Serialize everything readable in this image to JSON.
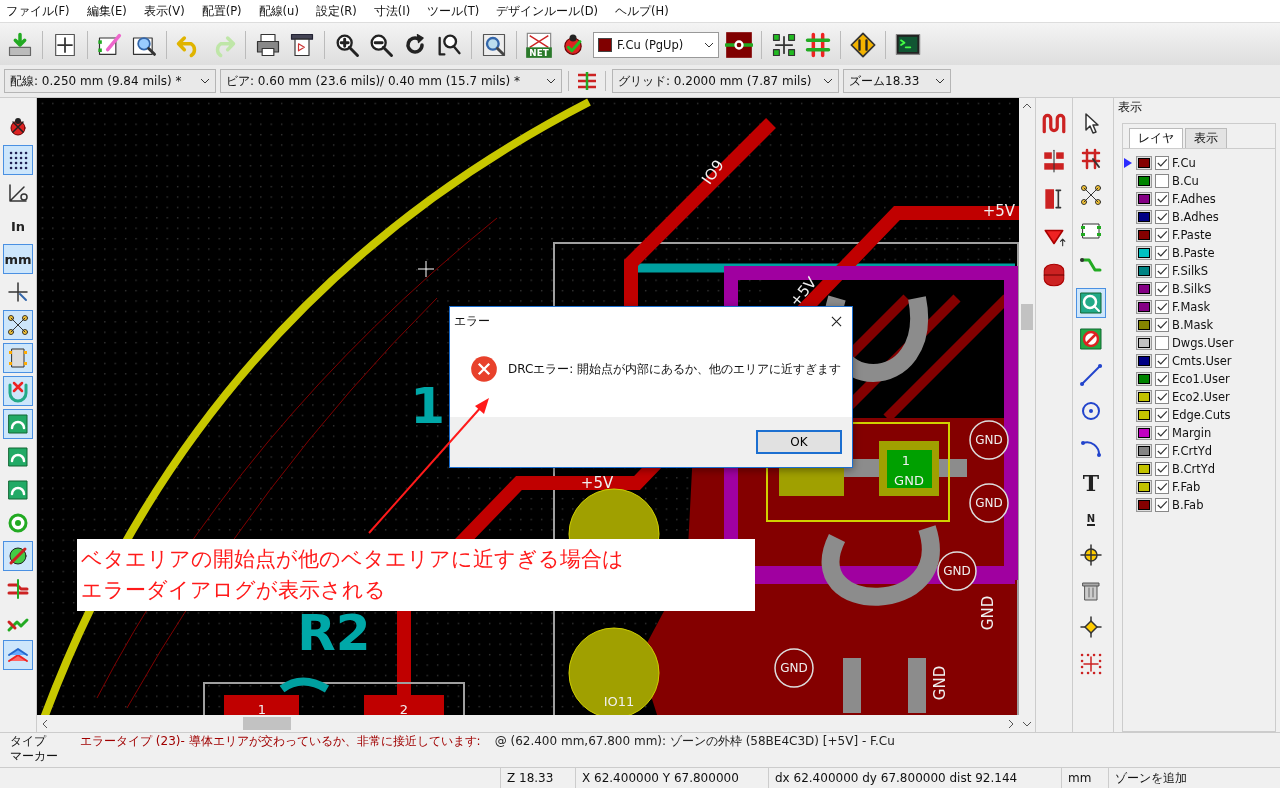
{
  "menu": [
    {
      "label": "ファイル(F)"
    },
    {
      "label": "編集(E)"
    },
    {
      "label": "表示(V)"
    },
    {
      "label": "配置(P)"
    },
    {
      "label": "配線(u)"
    },
    {
      "label": "設定(R)"
    },
    {
      "label": "寸法(I)"
    },
    {
      "label": "ツール(T)"
    },
    {
      "label": "デザインルール(D)"
    },
    {
      "label": "ヘルプ(H)"
    }
  ],
  "toolbar": {
    "net_icon_label": "NET",
    "layer_select": "F.Cu (PgUp)"
  },
  "options_bar": {
    "track": "配線: 0.250 mm (9.84 mils) *",
    "via": "ビア: 0.60 mm (23.6 mils)/ 0.40 mm (15.7 mils) *",
    "grid": "グリッド: 0.2000 mm (7.87 mils)",
    "zoom": "ズーム18.33"
  },
  "left_toolbar": [
    {
      "kind": "drc",
      "selected": false
    },
    {
      "kind": "grid",
      "selected": true
    },
    {
      "kind": "polar",
      "selected": false
    },
    {
      "kind": "inch",
      "label": "In",
      "selected": false
    },
    {
      "kind": "mm",
      "label": "mm",
      "selected": true
    },
    {
      "kind": "cursor",
      "selected": false
    },
    {
      "kind": "ratsnest",
      "selected": true
    },
    {
      "kind": "module",
      "selected": true
    },
    {
      "kind": "autodelete",
      "selected": true
    },
    {
      "kind": "zone",
      "selected": true
    },
    {
      "kind": "zone",
      "selected": false
    },
    {
      "kind": "zone",
      "selected": false
    },
    {
      "kind": "pad",
      "selected": false
    },
    {
      "kind": "via",
      "selected": true
    },
    {
      "kind": "track",
      "selected": false
    },
    {
      "kind": "contrast",
      "selected": false
    },
    {
      "kind": "layers",
      "selected": true
    }
  ],
  "right_toolbar_1": [
    {
      "kind": "wave"
    },
    {
      "kind": "gap"
    },
    {
      "kind": "stub"
    },
    {
      "kind": "polygon"
    },
    {
      "kind": "arc"
    }
  ],
  "right_toolbar_2": [
    {
      "kind": "arrow",
      "selected": false
    },
    {
      "kind": "highlight",
      "selected": false
    },
    {
      "kind": "ratsnest",
      "selected": false
    },
    {
      "kind": "footprint",
      "selected": false
    },
    {
      "kind": "route",
      "selected": false
    },
    {
      "kind": "zone",
      "selected": true
    },
    {
      "kind": "keepout",
      "selected": false
    },
    {
      "kind": "line",
      "selected": false
    },
    {
      "kind": "circle",
      "selected": false
    },
    {
      "kind": "arc",
      "selected": false
    },
    {
      "kind": "text",
      "label": "T",
      "selected": false
    },
    {
      "kind": "dimension",
      "label": "N",
      "selected": false
    },
    {
      "kind": "target",
      "selected": false
    },
    {
      "kind": "delete",
      "selected": false
    },
    {
      "kind": "anchor",
      "selected": false
    },
    {
      "kind": "origin",
      "selected": false
    }
  ],
  "layers": {
    "title": "表示",
    "tabs": [
      {
        "label": "レイヤ",
        "selected": true
      },
      {
        "label": "表示",
        "selected": false
      }
    ],
    "items": [
      {
        "name": "F.Cu",
        "color": "#840000",
        "visible": true,
        "selected": true
      },
      {
        "name": "B.Cu",
        "color": "#008400",
        "visible": false,
        "selected": false
      },
      {
        "name": "F.Adhes",
        "color": "#840084",
        "visible": true,
        "selected": false
      },
      {
        "name": "B.Adhes",
        "color": "#000084",
        "visible": true,
        "selected": false
      },
      {
        "name": "F.Paste",
        "color": "#840000",
        "visible": true,
        "selected": false
      },
      {
        "name": "B.Paste",
        "color": "#00c2c2",
        "visible": true,
        "selected": false
      },
      {
        "name": "F.SilkS",
        "color": "#008484",
        "visible": true,
        "selected": false
      },
      {
        "name": "B.SilkS",
        "color": "#840084",
        "visible": true,
        "selected": false
      },
      {
        "name": "F.Mask",
        "color": "#840084",
        "visible": true,
        "selected": false
      },
      {
        "name": "B.Mask",
        "color": "#848400",
        "visible": true,
        "selected": false
      },
      {
        "name": "Dwgs.User",
        "color": "#c2c2c2",
        "visible": false,
        "selected": false
      },
      {
        "name": "Cmts.User",
        "color": "#000084",
        "visible": true,
        "selected": false
      },
      {
        "name": "Eco1.User",
        "color": "#008400",
        "visible": true,
        "selected": false
      },
      {
        "name": "Eco2.User",
        "color": "#c2c200",
        "visible": true,
        "selected": false
      },
      {
        "name": "Edge.Cuts",
        "color": "#c2c200",
        "visible": true,
        "selected": false
      },
      {
        "name": "Margin",
        "color": "#c200c2",
        "visible": true,
        "selected": false
      },
      {
        "name": "F.CrtYd",
        "color": "#848484",
        "visible": true,
        "selected": false
      },
      {
        "name": "B.CrtYd",
        "color": "#c2c200",
        "visible": true,
        "selected": false
      },
      {
        "name": "F.Fab",
        "color": "#c2c200",
        "visible": true,
        "selected": false
      },
      {
        "name": "B.Fab",
        "color": "#840000",
        "visible": true,
        "selected": false
      }
    ]
  },
  "board": {
    "labels": [
      {
        "kind": "net",
        "text": "IO9"
      },
      {
        "kind": "net",
        "text": "+5V"
      },
      {
        "kind": "net",
        "text": "+5V"
      },
      {
        "kind": "net",
        "text": "+5V"
      },
      {
        "kind": "pad",
        "text": "1"
      },
      {
        "kind": "pad",
        "text": "GND"
      },
      {
        "kind": "ring",
        "text": "GND"
      },
      {
        "kind": "ring",
        "text": "GND"
      },
      {
        "kind": "ring",
        "text": "GND"
      },
      {
        "kind": "ring",
        "text": "GND"
      },
      {
        "kind": "net",
        "text": "GND"
      },
      {
        "kind": "net",
        "text": "GND"
      },
      {
        "kind": "pad",
        "text": "IO11"
      },
      {
        "kind": "silk",
        "text": "R2"
      },
      {
        "kind": "silk",
        "text": "1"
      },
      {
        "kind": "pad",
        "text": "1"
      },
      {
        "kind": "pad",
        "text": "2"
      }
    ]
  },
  "dialog": {
    "title": "エラー",
    "message": "DRCエラー: 開始点が内部にあるか、他のエリアに近すぎます",
    "button": "OK"
  },
  "annotation": {
    "lines": [
      "ベタエリアの開始点が他のベタエリアに近すぎる場合は",
      "エラーダイアログが表示される"
    ]
  },
  "messages": {
    "column_1": [
      "タイプ",
      "マーカー"
    ],
    "error": "エラータイプ (23)- 導体エリアが交わっているか、非常に接近しています:",
    "location": "@ (62.400 mm,67.800 mm): ゾーンの外枠  (58BE4C3D) [+5V] - F.Cu"
  },
  "status_bar": [
    "Z 18.33",
    "X 62.400000  Y 67.800000",
    "dx 62.400000  dy 67.800000  dist 92.144",
    "mm",
    "ゾーンを追加"
  ]
}
